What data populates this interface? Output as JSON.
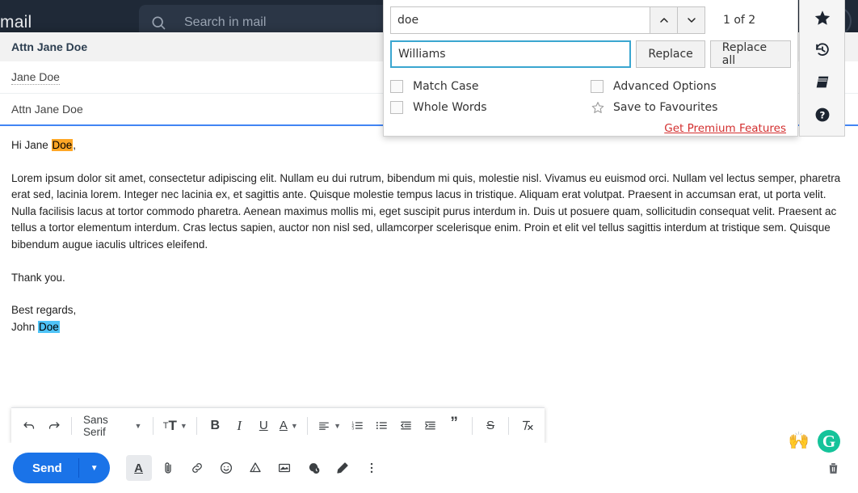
{
  "header": {
    "logo_text": "mail",
    "search_placeholder": "Search in mail",
    "search_icon": "search-icon",
    "avatar_icon": "account-circle-icon",
    "collapse_icon": "chevron-left-icon"
  },
  "compose": {
    "title": "Attn Jane Doe",
    "recipient": "Jane Doe",
    "subject": "Attn Jane Doe",
    "greeting_prefix": "Hi Jane ",
    "greeting_match": "Doe",
    "greeting_suffix": ",",
    "paragraph": "Lorem ipsum dolor sit amet, consectetur adipiscing elit. Nullam eu dui rutrum, bibendum mi quis, molestie nisl. Vivamus eu euismod orci. Nullam vel lectus semper, pharetra erat sed, lacinia lorem. Integer nec lacinia ex, et sagittis ante. Quisque molestie tempus lacus in tristique. Aliquam erat volutpat. Praesent in accumsan erat, ut porta velit. Nulla facilisis lacus at tortor commodo pharetra. Aenean maximus mollis mi, eget suscipit purus interdum in. Duis ut posuere quam, sollicitudin consequat velit. Praesent ac tellus a tortor elementum interdum. Cras lectus sapien, auctor non nisl sed, ullamcorper scelerisque enim. Proin et elit vel tellus sagittis interdum at tristique sem. Quisque bibendum augue iaculis ultrices eleifend.",
    "thanks": "Thank you.",
    "signoff": "Best regards,",
    "signature_prefix": "John ",
    "signature_match": "Doe",
    "highlight_color_inactive": "#ffa726",
    "highlight_color_active": "#4fc3f7"
  },
  "format_toolbar": {
    "undo_icon": "undo-icon",
    "redo_icon": "redo-icon",
    "font_family": "Sans Serif",
    "text_size_label": "T",
    "bold_label": "B",
    "italic_label": "I",
    "underline_label": "U",
    "text_color_label": "A",
    "align_icon": "align-left-icon",
    "numbered_list_icon": "numbered-list-icon",
    "bulleted_list_icon": "bulleted-list-icon",
    "indent_less_icon": "indent-decrease-icon",
    "indent_more_icon": "indent-increase-icon",
    "quote_label": "”",
    "strikethrough_label": "S",
    "remove_format_icon": "remove-formatting-icon"
  },
  "bottom_bar": {
    "send_label": "Send",
    "send_caret_icon": "chevron-down-icon",
    "formatting_icon": "format-text-icon",
    "attach_icon": "paperclip-icon",
    "link_icon": "link-icon",
    "emoji_icon": "emoji-icon",
    "drive_icon": "google-drive-icon",
    "image_icon": "insert-image-icon",
    "confidential_icon": "confidential-mode-icon",
    "signature_icon": "signature-pen-icon",
    "more_icon": "more-options-icon",
    "delete_icon": "trash-icon",
    "hands_emoji": "🙌",
    "grammarly_label": "G"
  },
  "find_replace": {
    "search_value": "doe",
    "replace_value": "Williams",
    "prev_icon": "chevron-up-icon",
    "next_icon": "chevron-down-icon",
    "match_count": "1 of 2",
    "replace_label": "Replace",
    "replace_all_label": "Replace all",
    "match_case_label": "Match Case",
    "whole_words_label": "Whole Words",
    "advanced_options_label": "Advanced Options",
    "save_favourites_label": "Save to Favourites",
    "premium_label": "Get Premium Features",
    "premium_color": "#d32f2f",
    "focus_border_color": "#3aa6d0"
  },
  "tool_rail": {
    "favourites_icon": "star-filled-icon",
    "history_icon": "history-icon",
    "dictionary_icon": "book-icon",
    "help_icon": "help-circle-icon"
  }
}
